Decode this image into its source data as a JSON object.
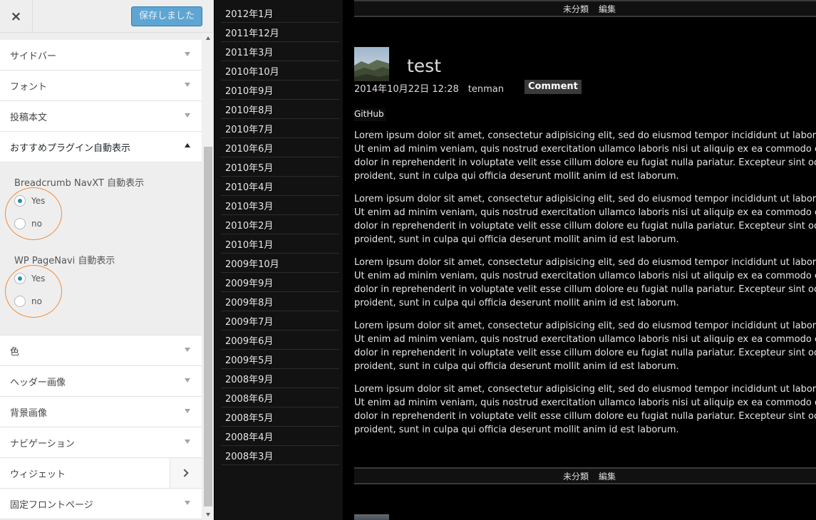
{
  "customizer": {
    "close_icon": "×",
    "save_label": "保存しました",
    "sections": [
      {
        "label": "サイドバー"
      },
      {
        "label": "フォント"
      },
      {
        "label": "投稿本文"
      },
      {
        "label": "おすすめプラグイン自動表示",
        "open": true
      },
      {
        "label": "色"
      },
      {
        "label": "ヘッダー画像"
      },
      {
        "label": "背景画像"
      },
      {
        "label": "ナビゲーション"
      },
      {
        "label": "ウィジェット"
      },
      {
        "label": "固定フロントページ"
      }
    ],
    "open_section": {
      "groups": [
        {
          "title": "Breadcrumb NavXT 自動表示",
          "options": [
            "Yes",
            "no"
          ],
          "selected": "Yes"
        },
        {
          "title": "WP PageNavi  自動表示",
          "options": [
            "Yes",
            "no"
          ],
          "selected": "Yes"
        }
      ]
    },
    "annotation_color": "#ef8c3a"
  },
  "archive": {
    "items": [
      "2012年1月",
      "2011年12月",
      "2011年3月",
      "2010年10月",
      "2010年9月",
      "2010年8月",
      "2010年7月",
      "2010年6月",
      "2010年5月",
      "2010年4月",
      "2010年3月",
      "2010年2月",
      "2010年1月",
      "2009年10月",
      "2009年9月",
      "2009年8月",
      "2009年7月",
      "2009年6月",
      "2009年5月",
      "2008年9月",
      "2008年6月",
      "2008年5月",
      "2008年4月",
      "2008年3月"
    ]
  },
  "post": {
    "top_meta": {
      "category": "未分類",
      "edit": "編集"
    },
    "title": "test",
    "date": "2014年10月22日 12:28",
    "author": "tenman",
    "comment_label": "Comment",
    "github_label": "GitHub",
    "paragraphs": [
      [
        "Lorem ipsum dolor sit amet, consectetur adipisicing elit, sed do eiusmod tempor incididunt ut labore e",
        "Ut enim ad minim veniam, quis nostrud exercitation ullamco laboris nisi ut aliquip ex ea commodo cor",
        "dolor in reprehenderit in voluptate velit esse cillum dolore eu fugiat nulla pariatur. Excepteur sint occa",
        "proident, sunt in culpa qui officia deserunt mollit anim id est laborum."
      ],
      [
        "Lorem ipsum dolor sit amet, consectetur adipisicing elit, sed do eiusmod tempor incididunt ut labore e",
        "Ut enim ad minim veniam, quis nostrud exercitation ullamco laboris nisi ut aliquip ex ea commodo cor",
        "dolor in reprehenderit in voluptate velit esse cillum dolore eu fugiat nulla pariatur. Excepteur sint occa",
        "proident, sunt in culpa qui officia deserunt mollit anim id est laborum."
      ],
      [
        "Lorem ipsum dolor sit amet, consectetur adipisicing elit, sed do eiusmod tempor incididunt ut labore e",
        "Ut enim ad minim veniam, quis nostrud exercitation ullamco laboris nisi ut aliquip ex ea commodo cor",
        "dolor in reprehenderit in voluptate velit esse cillum dolore eu fugiat nulla pariatur. Excepteur sint occa",
        "proident, sunt in culpa qui officia deserunt mollit anim id est laborum."
      ],
      [
        "Lorem ipsum dolor sit amet, consectetur adipisicing elit, sed do eiusmod tempor incididunt ut labore e",
        "Ut enim ad minim veniam, quis nostrud exercitation ullamco laboris nisi ut aliquip ex ea commodo cor",
        "dolor in reprehenderit in voluptate velit esse cillum dolore eu fugiat nulla pariatur. Excepteur sint occa",
        "proident, sunt in culpa qui officia deserunt mollit anim id est laborum."
      ],
      [
        "Lorem ipsum dolor sit amet, consectetur adipisicing elit, sed do eiusmod tempor incididunt ut labore e",
        "Ut enim ad minim veniam, quis nostrud exercitation ullamco laboris nisi ut aliquip ex ea commodo cor",
        "dolor in reprehenderit in voluptate velit esse cillum dolore eu fugiat nulla pariatur. Excepteur sint occa",
        "proident, sunt in culpa qui officia deserunt mollit anim id est laborum."
      ]
    ],
    "bottom_meta": {
      "category": "未分類",
      "edit": "編集"
    }
  }
}
